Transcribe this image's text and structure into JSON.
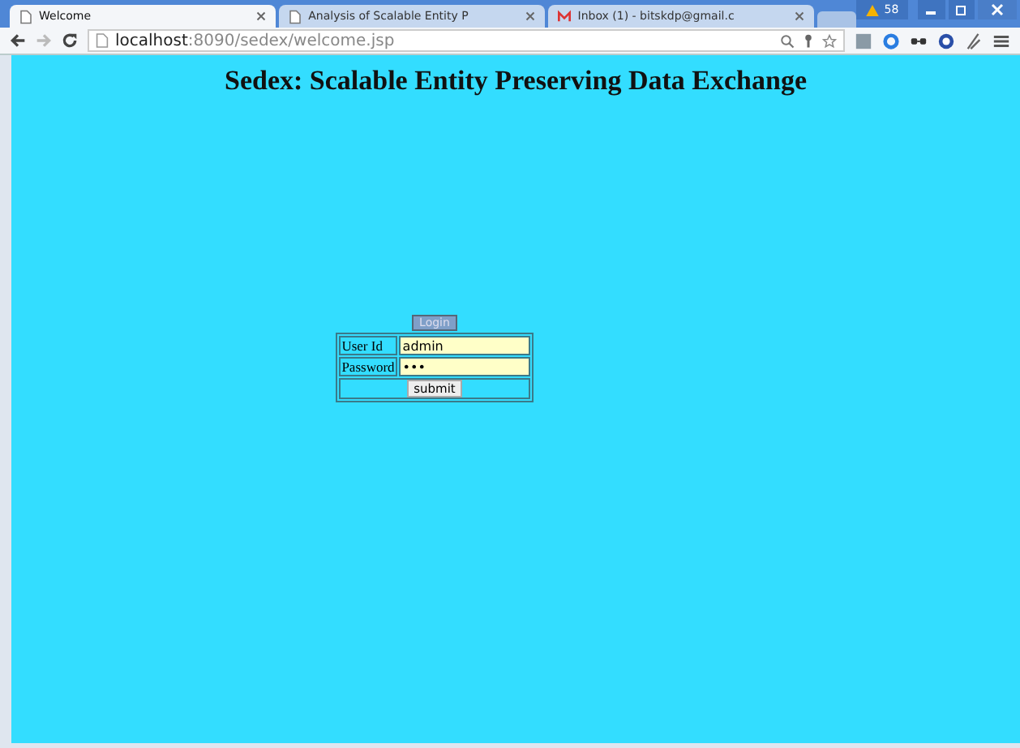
{
  "tabs": [
    {
      "label": "Welcome",
      "selected": true,
      "kind": "page"
    },
    {
      "label": "Analysis of Scalable Entity P",
      "selected": false,
      "kind": "page"
    },
    {
      "label": "Inbox (1) - bitskdp@gmail.c",
      "selected": false,
      "kind": "mail"
    }
  ],
  "window": {
    "badge": "58"
  },
  "address": {
    "host": "localhost",
    "path": ":8090/sedex/welcome.jsp"
  },
  "page": {
    "title": "Sedex: Scalable Entity Preserving Data Exchange",
    "login_label": "Login",
    "fields": [
      {
        "label": "User Id",
        "value": "admin"
      },
      {
        "label": "Password",
        "value": "•••"
      }
    ],
    "submit": "submit"
  }
}
